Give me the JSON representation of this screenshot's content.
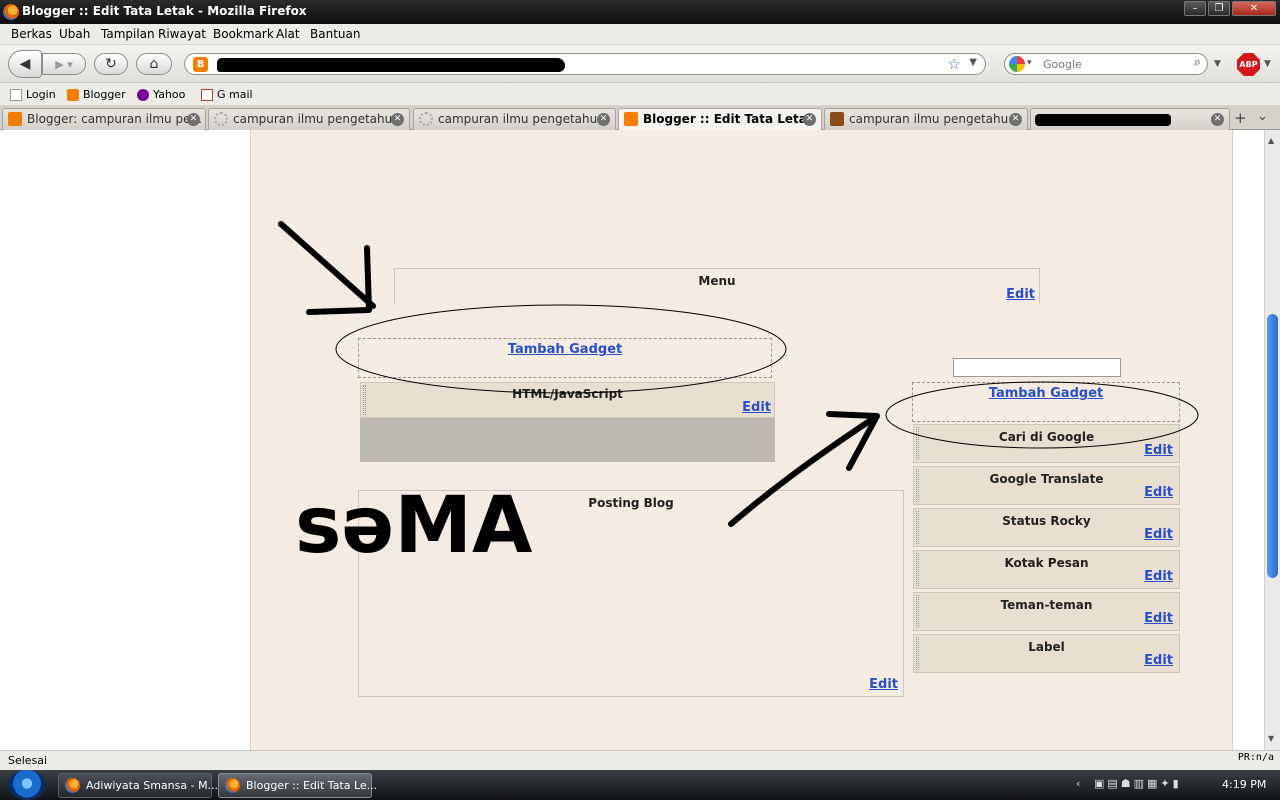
{
  "window": {
    "title": "Blogger :: Edit Tata Letak - Mozilla Firefox"
  },
  "menu": [
    "Berkas",
    "Ubah",
    "Tampilan",
    "Riwayat",
    "Bookmark",
    "Alat",
    "Bantuan"
  ],
  "search": {
    "placeholder": "Google"
  },
  "bookmarks": [
    "Login",
    "Blogger",
    "Yahoo",
    "G mail"
  ],
  "tabs": [
    {
      "label": "Blogger: campuran ilmu pe...",
      "active": false
    },
    {
      "label": "campuran ilmu pengetahu...",
      "active": false
    },
    {
      "label": "campuran ilmu pengetahu...",
      "active": false
    },
    {
      "label": "Blogger :: Edit Tata Letak",
      "active": true
    },
    {
      "label": "campuran ilmu pengetahu...",
      "active": false
    }
  ],
  "layout": {
    "menu_widget": {
      "title": "Menu",
      "edit": "Edit"
    },
    "add_gadget_main": "Tambah Gadget",
    "html_widget": {
      "title": "HTML/JavaScript",
      "edit": "Edit"
    },
    "posting": {
      "title": "Posting Blog",
      "edit": "Edit"
    },
    "add_gadget_sidebar": "Tambah Gadget",
    "sidebar_widgets": [
      {
        "title": "Cari di Google",
        "edit": "Edit"
      },
      {
        "title": "Google Translate",
        "edit": "Edit"
      },
      {
        "title": "Status Rocky",
        "edit": "Edit"
      },
      {
        "title": "Kotak Pesan",
        "edit": "Edit"
      },
      {
        "title": "Teman-teman",
        "edit": "Edit"
      },
      {
        "title": "Label",
        "edit": "Edit"
      }
    ]
  },
  "annotation_text": "səMA",
  "status": {
    "text": "Selesai",
    "pr": "PR:n/a"
  },
  "taskbar": {
    "items": [
      "Adiwiyata Smansa - M...",
      "Blogger :: Edit Tata Le..."
    ],
    "clock": "4:19 PM"
  },
  "colors": {
    "canvas": "#f4ebe2",
    "link": "#2a4fc9",
    "widget": "#e8dfd0"
  }
}
